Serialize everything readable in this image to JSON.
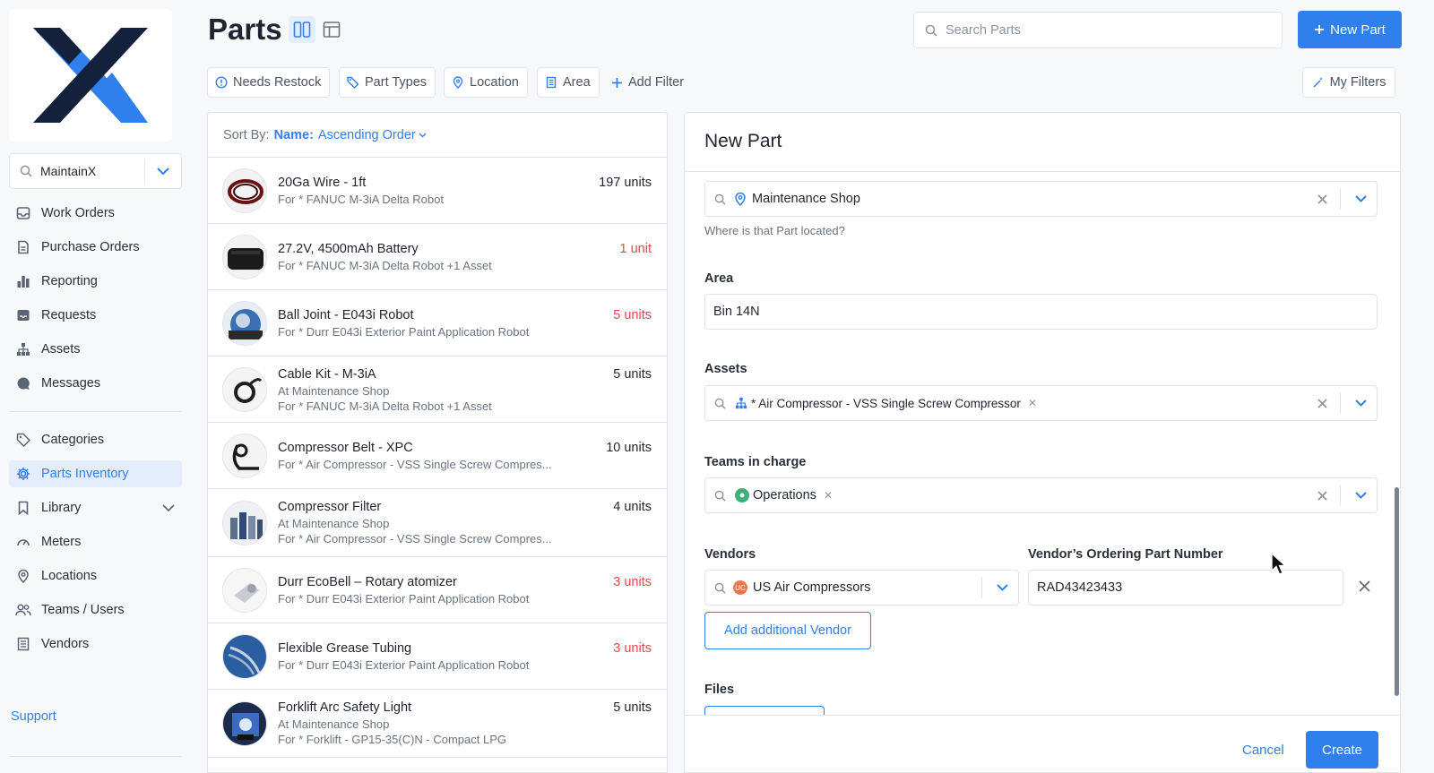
{
  "app": {
    "org_name": "MaintainX"
  },
  "sidebar": {
    "items": [
      {
        "label": "Work Orders",
        "icon": "inbox-icon"
      },
      {
        "label": "Purchase Orders",
        "icon": "document-icon"
      },
      {
        "label": "Reporting",
        "icon": "bar-chart-icon"
      },
      {
        "label": "Requests",
        "icon": "tray-icon"
      },
      {
        "label": "Assets",
        "icon": "hierarchy-icon"
      },
      {
        "label": "Messages",
        "icon": "chat-icon"
      }
    ],
    "items2": [
      {
        "label": "Categories",
        "icon": "tag-icon"
      },
      {
        "label": "Parts Inventory",
        "icon": "gear-icon",
        "active": true
      },
      {
        "label": "Library",
        "icon": "bookmark-icon"
      },
      {
        "label": "Meters",
        "icon": "gauge-icon"
      },
      {
        "label": "Locations",
        "icon": "pin-icon"
      },
      {
        "label": "Teams / Users",
        "icon": "users-icon"
      },
      {
        "label": "Vendors",
        "icon": "building-icon"
      }
    ],
    "support_label": "Support"
  },
  "header": {
    "title": "Parts",
    "search_placeholder": "Search Parts",
    "new_part_label": "New Part"
  },
  "filters": {
    "chips": [
      "Needs Restock",
      "Part Types",
      "Location",
      "Area"
    ],
    "add_filter_label": "Add Filter",
    "my_filters_label": "My Filters"
  },
  "list": {
    "sort_label": "Sort By:",
    "sort_field": "Name:",
    "sort_order": "Ascending Order",
    "parts": [
      {
        "name": "20Ga Wire - 1ft",
        "lines": [
          "For * FANUC M-3iA Delta Robot"
        ],
        "qty": "197 units",
        "low": false
      },
      {
        "name": "27.2V, 4500mAh Battery",
        "lines": [
          "For * FANUC M-3iA Delta Robot +1 Asset"
        ],
        "qty": "1 unit",
        "low": true
      },
      {
        "name": "Ball Joint - E043i Robot",
        "lines": [
          "For * Durr E043i Exterior Paint Application Robot"
        ],
        "qty": "5 units",
        "low": true
      },
      {
        "name": "Cable Kit - M-3iA",
        "lines": [
          "At Maintenance Shop",
          "For * FANUC M-3iA Delta Robot +1 Asset"
        ],
        "qty": "5 units",
        "low": false
      },
      {
        "name": "Compressor Belt - XPC",
        "lines": [
          "For * Air Compressor - VSS Single Screw Compres..."
        ],
        "qty": "10 units",
        "low": false
      },
      {
        "name": "Compressor Filter",
        "lines": [
          "At Maintenance Shop",
          "For * Air Compressor - VSS Single Screw Compres..."
        ],
        "qty": "4 units",
        "low": false
      },
      {
        "name": "Durr EcoBell – Rotary atomizer",
        "lines": [
          "For * Durr E043i Exterior Paint Application Robot"
        ],
        "qty": "3 units",
        "low": true
      },
      {
        "name": "Flexible Grease Tubing",
        "lines": [
          "For * Durr E043i Exterior Paint Application Robot"
        ],
        "qty": "3 units",
        "low": true
      },
      {
        "name": "Forklift Arc Safety Light",
        "lines": [
          "At Maintenance Shop",
          "For * Forklift - GP15-35(C)N - Compact LPG"
        ],
        "qty": "5 units",
        "low": false
      }
    ]
  },
  "form": {
    "title": "New Part",
    "location_value": "Maintenance Shop",
    "location_helper": "Where is that Part located?",
    "area_label": "Area",
    "area_value": "Bin 14N",
    "assets_label": "Assets",
    "asset_tag": "* Air Compressor - VSS Single Screw Compressor",
    "teams_label": "Teams in charge",
    "team_tag": "Operations",
    "vendors_label": "Vendors",
    "vendor_part_label": "Vendor’s Ordering Part Number",
    "vendor_value": "US Air Compressors",
    "vendor_initials": "UC",
    "vendor_part_number": "RAD43423433",
    "add_vendor_label": "Add additional Vendor",
    "files_label": "Files",
    "cancel_label": "Cancel",
    "create_label": "Create"
  },
  "colors": {
    "accent": "#2f80ed",
    "danger": "#e5484d",
    "logo_dark": "#13213c",
    "logo_blue": "#2f80ed"
  }
}
